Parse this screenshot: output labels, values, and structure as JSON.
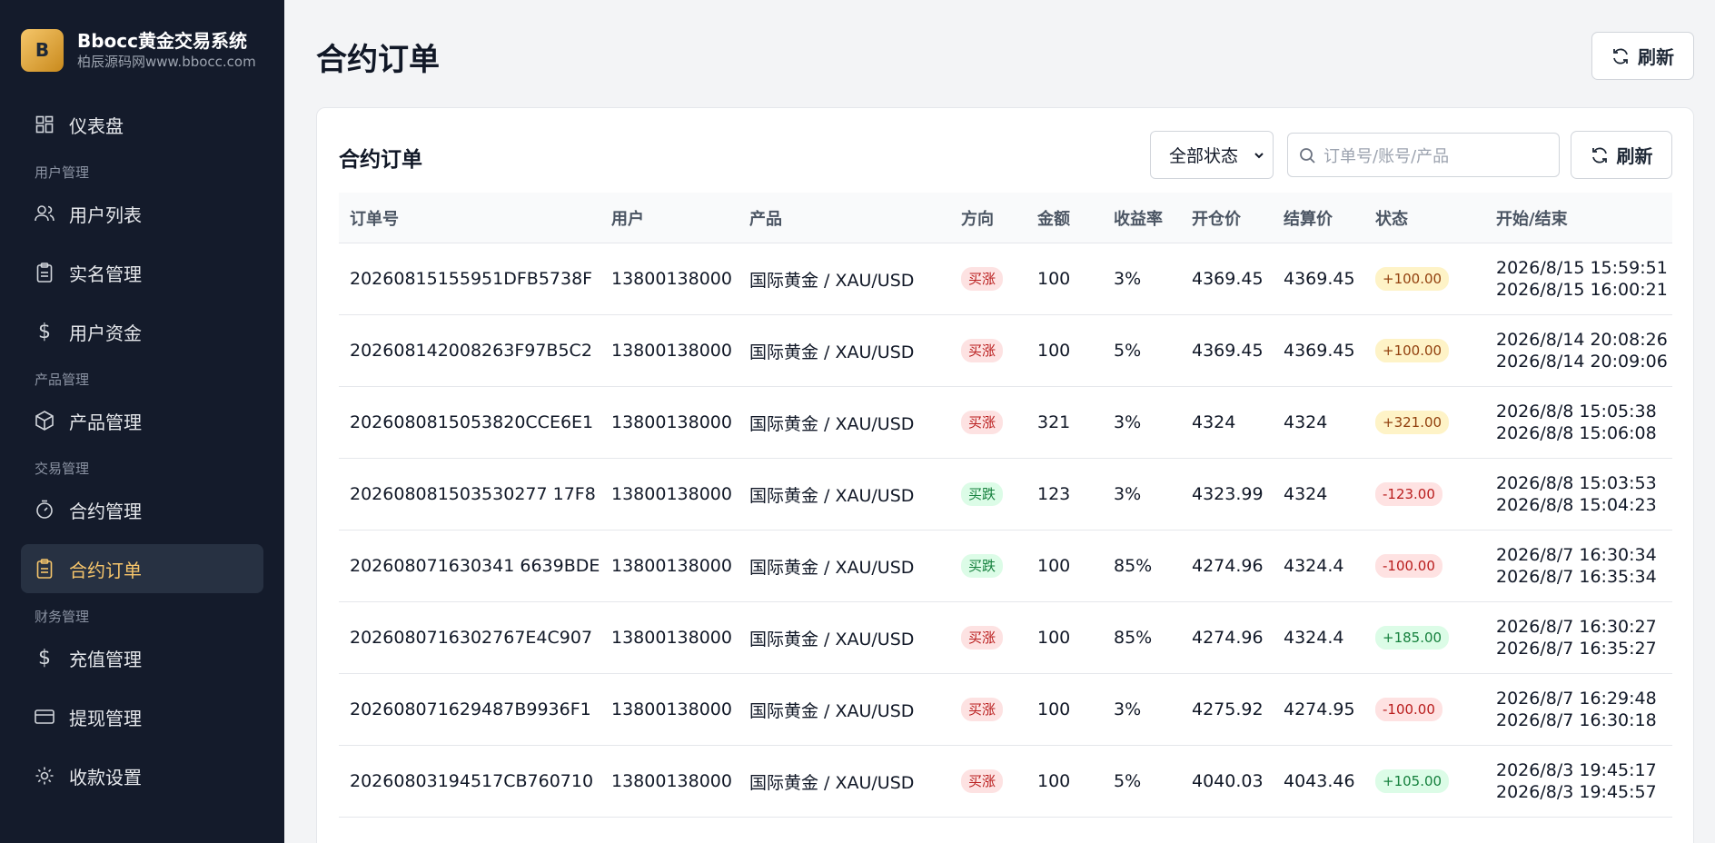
{
  "brand": {
    "logo_letter": "B",
    "title": "Bbocc黄金交易系统",
    "subtitle": "柏辰源码网www.bbocc.com"
  },
  "nav": {
    "dashboard": "仪表盘",
    "section_user": "用户管理",
    "user_list": "用户列表",
    "realname": "实名管理",
    "user_funds": "用户资金",
    "section_product": "产品管理",
    "product_mgmt": "产品管理",
    "section_trade": "交易管理",
    "contract_mgmt": "合约管理",
    "contract_orders": "合约订单",
    "section_finance": "财务管理",
    "recharge": "充值管理",
    "withdraw": "提现管理",
    "payment_settings": "收款设置"
  },
  "header": {
    "title": "合约订单",
    "refresh_label": "刷新"
  },
  "card": {
    "title": "合约订单",
    "status_filter": "全部状态",
    "search_placeholder": "订单号/账号/产品",
    "refresh_label": "刷新"
  },
  "table": {
    "headers": [
      "订单号",
      "用户",
      "产品",
      "方向",
      "金额",
      "收益率",
      "开仓价",
      "结算价",
      "状态",
      "开始/结束"
    ],
    "rows": [
      {
        "order": "20260815155951DFB5738F",
        "user": "13800138000",
        "product": "国际黄金 / XAU/USD",
        "dir": "买涨",
        "amount": "100",
        "rate": "3%",
        "open": "4369.45",
        "settle": "4369.45",
        "status": "+100.00",
        "start": "2026/8/15 15:59:51",
        "end": "2026/8/15 16:00:21"
      },
      {
        "order": "202608142008263F97B5C2",
        "user": "13800138000",
        "product": "国际黄金 / XAU/USD",
        "dir": "买涨",
        "amount": "100",
        "rate": "5%",
        "open": "4369.45",
        "settle": "4369.45",
        "status": "+100.00",
        "start": "2026/8/14 20:08:26",
        "end": "2026/8/14 20:09:06"
      },
      {
        "order": "2026080815053820CCE6E1",
        "user": "13800138000",
        "product": "国际黄金 / XAU/USD",
        "dir": "买涨",
        "amount": "321",
        "rate": "3%",
        "open": "4324",
        "settle": "4324",
        "status": "+321.00",
        "start": "2026/8/8 15:05:38",
        "end": "2026/8/8 15:06:08"
      },
      {
        "order": "202608081503530277 17F8",
        "user": "13800138000",
        "product": "国际黄金 / XAU/USD",
        "dir": "买跌",
        "amount": "123",
        "rate": "3%",
        "open": "4323.99",
        "settle": "4324",
        "status": "-123.00",
        "start": "2026/8/8 15:03:53",
        "end": "2026/8/8 15:04:23"
      },
      {
        "order": "202608071630341 6639BDE",
        "user": "13800138000",
        "product": "国际黄金 / XAU/USD",
        "dir": "买跌",
        "amount": "100",
        "rate": "85%",
        "open": "4274.96",
        "settle": "4324.4",
        "status": "-100.00",
        "start": "2026/8/7 16:30:34",
        "end": "2026/8/7 16:35:34"
      },
      {
        "order": "2026080716302767E4C907",
        "user": "13800138000",
        "product": "国际黄金 / XAU/USD",
        "dir": "买涨",
        "amount": "100",
        "rate": "85%",
        "open": "4274.96",
        "settle": "4324.4",
        "status": "+185.00",
        "start": "2026/8/7 16:30:27",
        "end": "2026/8/7 16:35:27"
      },
      {
        "order": "202608071629487B9936F1",
        "user": "13800138000",
        "product": "国际黄金 / XAU/USD",
        "dir": "买涨",
        "amount": "100",
        "rate": "3%",
        "open": "4275.92",
        "settle": "4274.95",
        "status": "-100.00",
        "start": "2026/8/7 16:29:48",
        "end": "2026/8/7 16:30:18"
      },
      {
        "order": "20260803194517CB760710",
        "user": "13800138000",
        "product": "国际黄金 / XAU/USD",
        "dir": "买涨",
        "amount": "100",
        "rate": "5%",
        "open": "4040.03",
        "settle": "4043.46",
        "status": "+105.00",
        "start": "2026/8/3 19:45:17",
        "end": "2026/8/3 19:45:57"
      }
    ]
  },
  "colors": {
    "sidebar_bg": "#141b2b",
    "accent": "#f6c56b",
    "up": "#b91c1c",
    "down": "#15803d"
  }
}
